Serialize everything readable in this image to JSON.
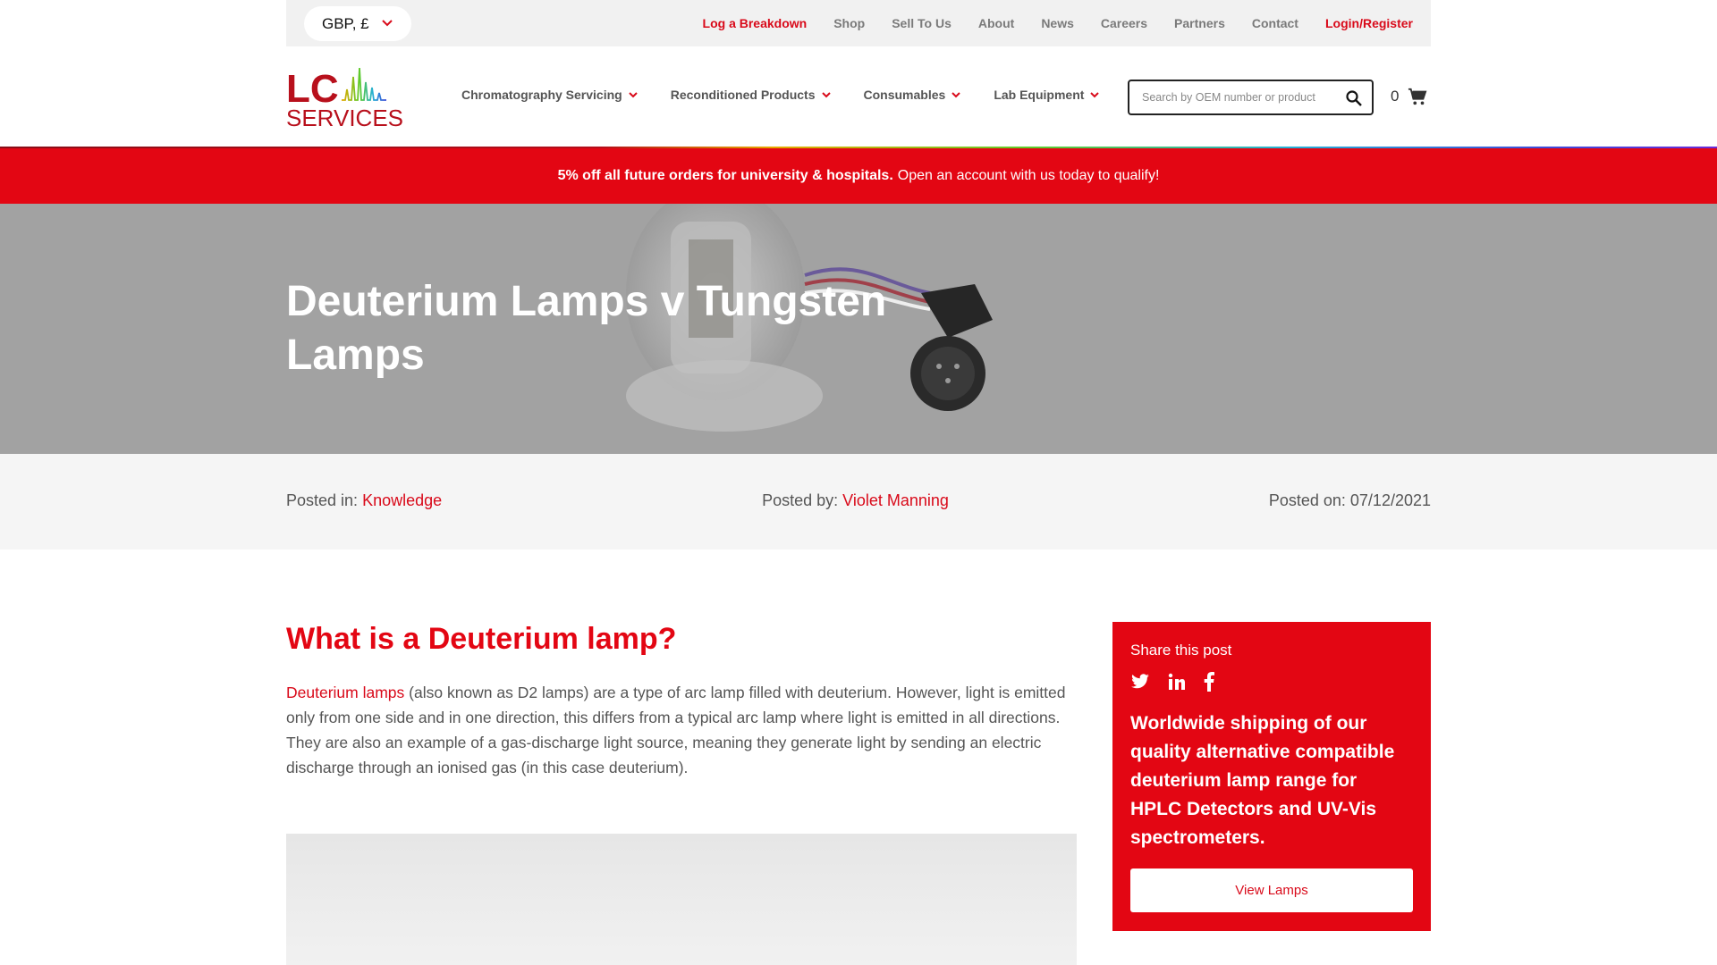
{
  "topbar": {
    "currency": "GBP, £",
    "links": [
      {
        "label": "Log a Breakdown",
        "red": true
      },
      {
        "label": "Shop"
      },
      {
        "label": "Sell To Us"
      },
      {
        "label": "About"
      },
      {
        "label": "News"
      },
      {
        "label": "Careers"
      },
      {
        "label": "Partners"
      },
      {
        "label": "Contact"
      },
      {
        "label": "Login/Register",
        "red": true
      }
    ]
  },
  "logo": {
    "line1": "LC",
    "line2": "SERVICES"
  },
  "nav": {
    "items": [
      "Chromatography Servicing",
      "Reconditioned Products",
      "Consumables",
      "Lab Equipment"
    ]
  },
  "search": {
    "placeholder": "Search by OEM number or product"
  },
  "cart": {
    "count": "0"
  },
  "promo": {
    "bold": "5% off all future orders for university & hospitals.",
    "text": "Open an account with us today to qualify!"
  },
  "hero": {
    "title": "Deuterium Lamps v Tungsten Lamps"
  },
  "meta": {
    "posted_in_label": "Posted in:",
    "posted_in": "Knowledge",
    "posted_by_label": "Posted by:",
    "posted_by": "Violet Manning",
    "posted_on_label": "Posted on:",
    "posted_on": "07/12/2021"
  },
  "article": {
    "heading": "What is a Deuterium lamp?",
    "link": "Deuterium lamps",
    "body": "(also known as D2 lamps) are a type of arc lamp filled with deuterium. However, light is emitted only from one side and in one direction, this differs from a typical arc lamp where light is emitted in all directions. They are also an example of a gas-discharge light source, meaning they generate light by sending an electric discharge through an ionised gas (in this case deuterium)."
  },
  "sidebar": {
    "share": "Share this post",
    "pitch": "Worldwide shipping of our quality alternative compatible deuterium lamp range for HPLC Detectors and UV-Vis spectrometers.",
    "button": "View Lamps"
  },
  "colors": {
    "brand_red": "#e30613",
    "text_grey": "#555555",
    "topbar_bg": "#f1f1f1"
  }
}
